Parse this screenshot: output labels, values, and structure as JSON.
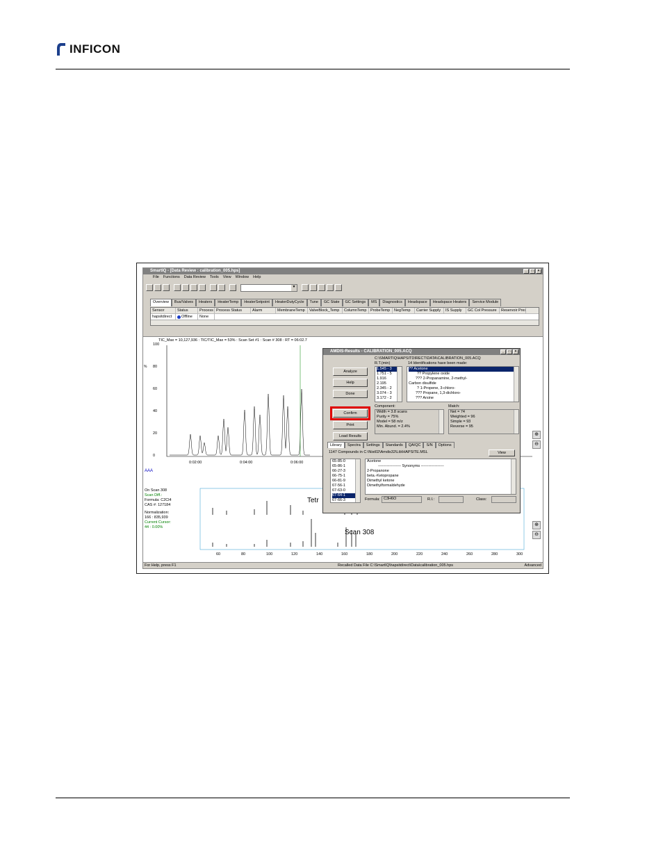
{
  "header": {
    "logo_text": "INFICON"
  },
  "app": {
    "title": "SmartIQ - [Data Review : calibration_005.hps]",
    "menu": [
      "File",
      "Functions",
      "Data Review",
      "Tools",
      "View",
      "Window",
      "Help"
    ],
    "tabs": [
      "Overview",
      "Bus/Valves",
      "Heaters",
      "HeaterTemp",
      "HeaterSetpoint",
      "HeaterDutyCycle",
      "Tune",
      "GC State",
      "GC Settings",
      "MS",
      "Diagnostics",
      "Headspace",
      "Headspace Heaters",
      "Service Module"
    ],
    "grid_headers": [
      "Sensor",
      "Status",
      "Process",
      "Process Status",
      "Alarm",
      "MembraneTemp",
      "ValveBlock_Temp",
      "ColumnTemp",
      "ProbeTemp",
      "NegTemp",
      "Carrier Supply",
      "IS Supply",
      "GC Col Pressure",
      "Reservoir Pres"
    ],
    "grid_row": [
      "hapsitdirect",
      "Offline",
      "None"
    ],
    "chart_header": "TIC_Max = 10,127,936 : TIC/TIC_Max = 53% : Scan Set #1 : Scan #    308 : RT = 06:02.7",
    "y_ticks": [
      "100",
      "80",
      "60",
      "40",
      "20",
      "0"
    ],
    "y_unit": "%",
    "x_ticks": [
      "0:02:00",
      "0:04:00",
      "0:06:00"
    ],
    "spectrum_info": [
      "On Scan 308",
      "Scan Diff.:",
      "Formula: C2Cl4",
      "CAS #: 127184",
      "Normalization:",
      "166 : 835,939",
      "Current Cursor:",
      "44 : 0.00%"
    ],
    "spectrum_top_label": "Tetr",
    "spectrum_bottom_label": "Scan 308",
    "mz_ticks": [
      "60",
      "80",
      "100",
      "120",
      "140",
      "160",
      "180",
      "200",
      "220",
      "240",
      "260",
      "280",
      "300"
    ],
    "status_left": "For Help, press F1",
    "status_mid": "Recalled Data File C:\\SmartIQ\\hapsitdirect\\Data\\calibration_005.hps",
    "status_right": "Advanced"
  },
  "dialog": {
    "title": "AMDIS-Results - CALIBRATION_005.ACQ",
    "path": "C:\\SMARTIQ\\HAPSITDIRECT\\DATA\\CALIBRATION_005.ACQ",
    "rt_label": "R.T.(min)",
    "ids_label": "14 Identifications have been made:",
    "rt_list": [
      "1.545 - 3",
      "1.751 - 5",
      "1.916",
      "2.195",
      "2.345 - 2",
      "3.074 - 3",
      "3.172 - 2"
    ],
    "ids_list": [
      "?? Acetone",
      "?? Propylene oxide",
      "??? 2-Propanamine, 2-methyl-",
      "Carbon disulfide",
      "? 1-Propene, 3-chloro-",
      "??? Propane, 1,3-dichloro-",
      "??? Arsine"
    ],
    "buttons": {
      "analyze": "Analyze",
      "help": "Help",
      "done": "Done",
      "confirm": "Confirm",
      "print": "Print",
      "load": "Load Results"
    },
    "component_label": "Component:",
    "component_lines": [
      "Width = 3.8 scans",
      "Purity = 75%",
      "Model = 58 m/z",
      "Min. Abund. = 2.4%"
    ],
    "match_label": "Match:",
    "match_lines": [
      "Net = 74",
      "Weighted = 96",
      "Simple = 93",
      "Reverse = 95"
    ],
    "lib_tabs": [
      "Library",
      "Spectra",
      "Settings",
      "Standards",
      "QA/QC",
      "S/N",
      "Options"
    ],
    "lib_path": "1147 Compounds in C:\\Nist02\\Amdis32\\Lib\\HAPSITE.MSL",
    "view_btn": "View",
    "cas_list": [
      "65-85-0",
      "65-86-1",
      "66-27-3",
      "66-75-1",
      "66-81-9",
      "67-56-1",
      "67-63-0",
      "67-64-1",
      "67-66-3"
    ],
    "compound_name": "Acetone",
    "synonyms_label": "------------------ Synonyms ------------------",
    "synonyms": [
      "2-Propanone",
      "beta.-Ketopropane",
      "Dimethyl ketone",
      "Dimethylformaldehyde"
    ],
    "formula_label": "Formula:",
    "formula": "C3H6O",
    "ri_label": "R.I.:",
    "class_label": "Class:"
  }
}
